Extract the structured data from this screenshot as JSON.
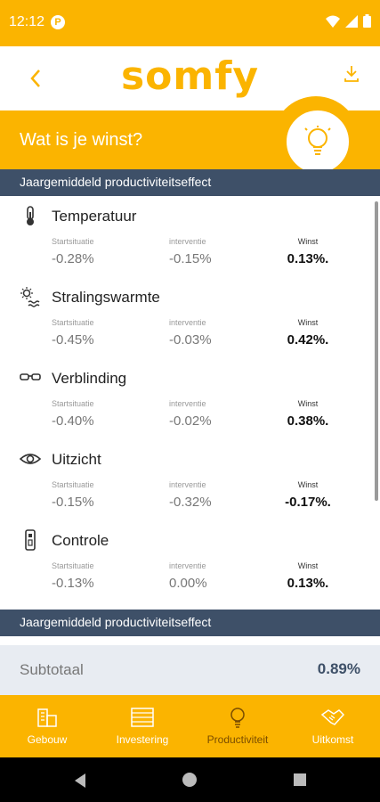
{
  "status_bar": {
    "time": "12:12",
    "notification_icon": "p-icon",
    "icons": [
      "wifi-icon",
      "signal-icon",
      "battery-icon"
    ]
  },
  "app_bar": {
    "logo": "somfy",
    "back_icon": "chevron-left-icon",
    "download_icon": "download-icon"
  },
  "hero": {
    "title": "Wat is je winst?",
    "icon": "lightbulb-icon"
  },
  "section_header": "Jaargemiddeld productiviteitseffect",
  "items": [
    {
      "name": "Temperatuur",
      "icon": "thermometer-icon",
      "start_label": "Startsituatie",
      "start_value": "-0.28%",
      "int_label": "interventie",
      "int_value": "-0.15%",
      "win_label": "Winst",
      "win_value": "0.13%."
    },
    {
      "name": "Stralingswarmte",
      "icon": "sun-heat-icon",
      "start_label": "Startsituatie",
      "start_value": "-0.45%",
      "int_label": "interventie",
      "int_value": "-0.03%",
      "win_label": "Winst",
      "win_value": "0.42%."
    },
    {
      "name": "Verblinding",
      "icon": "glasses-icon",
      "start_label": "Startsituatie",
      "start_value": "-0.40%",
      "int_label": "interventie",
      "int_value": "-0.02%",
      "win_label": "Winst",
      "win_value": "0.38%."
    },
    {
      "name": "Uitzicht",
      "icon": "eye-icon",
      "start_label": "Startsituatie",
      "start_value": "-0.15%",
      "int_label": "interventie",
      "int_value": "-0.32%",
      "win_label": "Winst",
      "win_value": "-0.17%."
    },
    {
      "name": "Controle",
      "icon": "remote-control-icon",
      "start_label": "Startsituatie",
      "start_value": "-0.13%",
      "int_label": "interventie",
      "int_value": "0.00%",
      "win_label": "Winst",
      "win_value": "0.13%."
    }
  ],
  "footer_header": "Jaargemiddeld productiviteitseffect",
  "subtotal": {
    "label": "Subtotaal",
    "value": "0.89%"
  },
  "tabs": [
    {
      "label": "Gebouw",
      "icon": "building-icon",
      "active": false
    },
    {
      "label": "Investering",
      "icon": "table-icon",
      "active": false
    },
    {
      "label": "Productiviteit",
      "icon": "lightbulb-icon",
      "active": true
    },
    {
      "label": "Uitkomst",
      "icon": "handshake-icon",
      "active": false
    }
  ],
  "colors": {
    "accent": "#fbb400",
    "navy": "#3e5068"
  }
}
